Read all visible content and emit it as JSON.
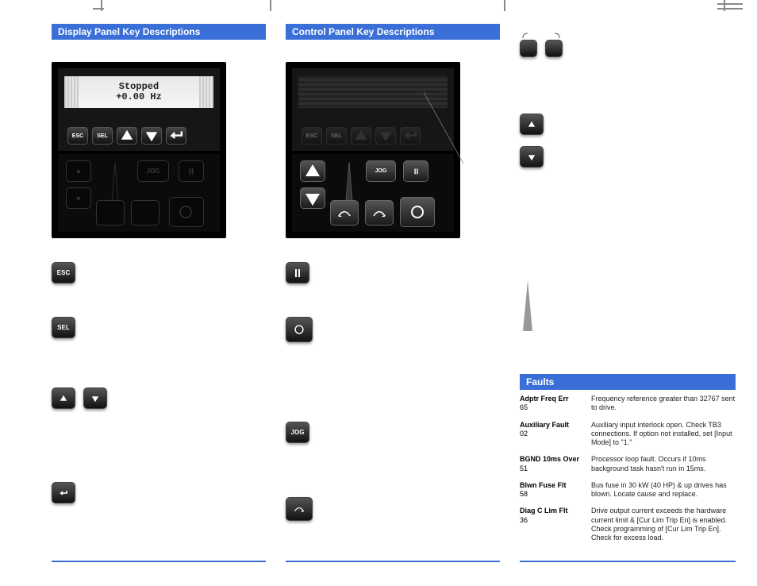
{
  "cropmarks": true,
  "headers": {
    "display": "Display Panel Key Descriptions",
    "control": "Control Panel Key Descriptions",
    "faults": "Faults"
  },
  "lcd": {
    "line1": "Stopped",
    "line2": "+0.00 Hz"
  },
  "keys": {
    "esc": "ESC",
    "sel": "SEL",
    "jog": "JOG"
  },
  "faults": [
    {
      "name": "Adptr Freq Err",
      "code": "65",
      "desc": "Frequency reference greater than 32767 sent to drive."
    },
    {
      "name": "Auxiliary Fault",
      "code": "02",
      "desc": "Auxiliary input interlock open. Check TB3 connections. If option not installed, set [Input Mode] to \"1.\""
    },
    {
      "name": "BGND 10ms Over",
      "code": "51",
      "desc": "Processor loop fault. Occurs if 10ms background task hasn't run in 15ms."
    },
    {
      "name": "Blwn Fuse Flt",
      "code": "58",
      "desc": "Bus fuse in 30 kW (40 HP) & up drives has blown. Locate cause and replace."
    },
    {
      "name": "Diag C Lim Flt",
      "code": "36",
      "desc": "Drive output current exceeds the hardware current limit & [Cur Lim Trip En] is enabled. Check programming of [Cur Lim Trip En]. Check for excess load."
    }
  ]
}
